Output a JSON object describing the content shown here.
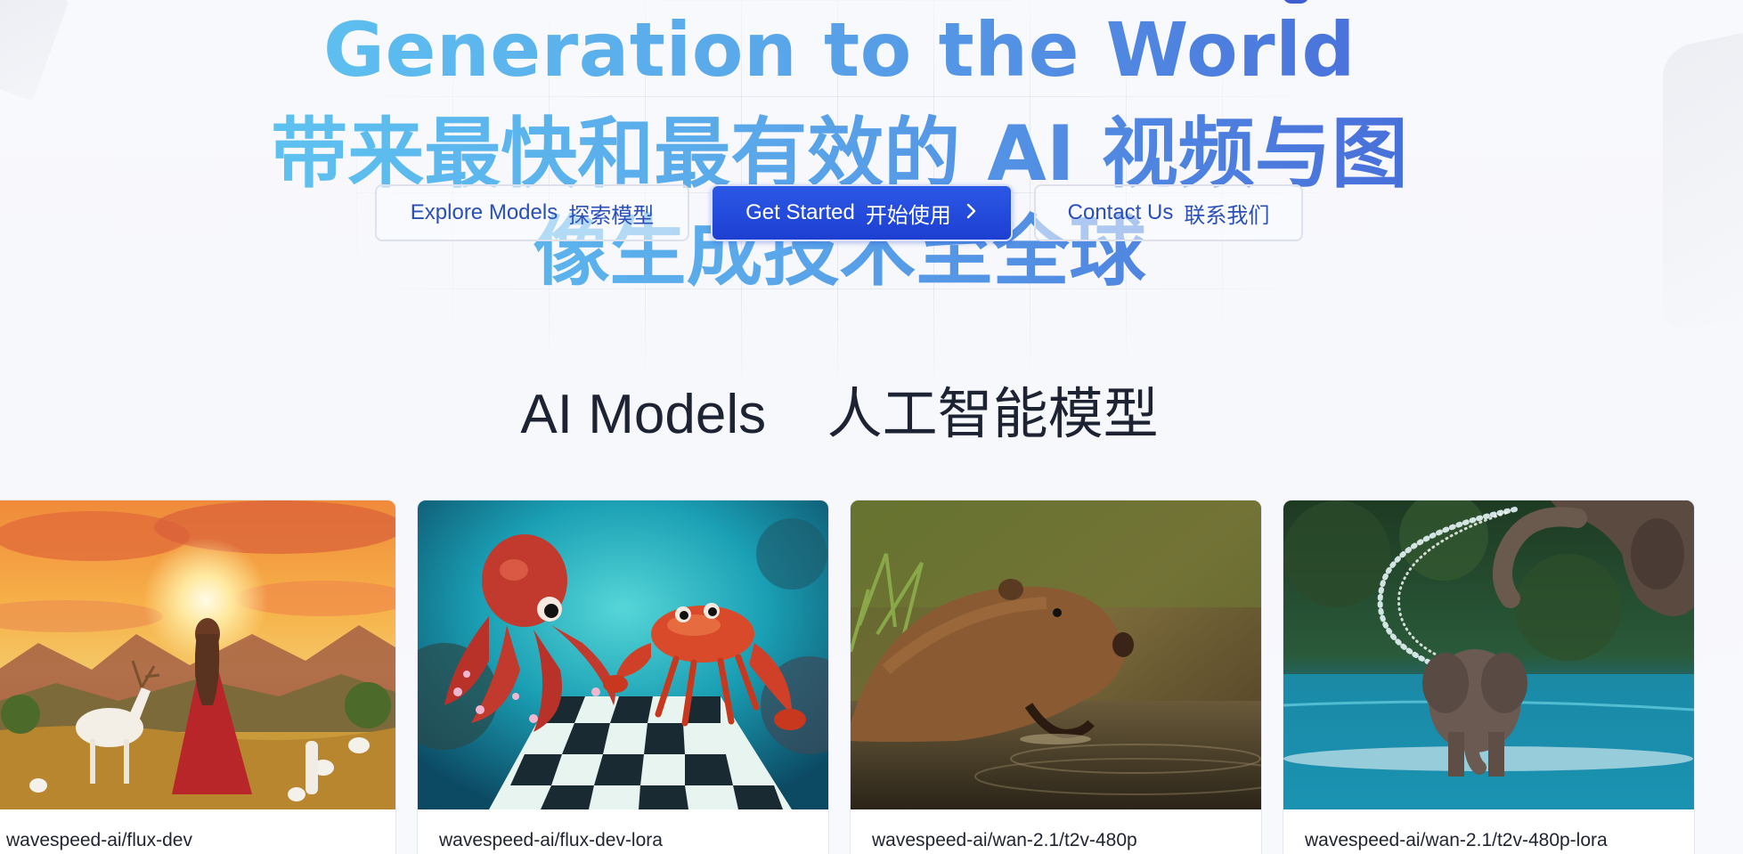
{
  "hero": {
    "headline_en": "Generation to the World",
    "headline_zh_line1": "带来最快和最有效的 AI 视频与图",
    "headline_zh_line2": "像生成技术至全球"
  },
  "cta": {
    "explore_en": "Explore Models",
    "explore_zh": "探索模型",
    "start_en": "Get Started",
    "start_zh": "开始使用",
    "start_icon": "chevron-right-icon",
    "contact_en": "Contact Us",
    "contact_zh": "联系我们"
  },
  "models_section": {
    "title_en": "AI Models",
    "title_zh": "人工智能模型",
    "cards": [
      {
        "model": "wavespeed-ai/flux-dev",
        "image": "girl-with-deer-sunset-image"
      },
      {
        "model": "wavespeed-ai/flux-dev-lora",
        "image": "octopus-crab-chess-image"
      },
      {
        "model": "wavespeed-ai/wan-2.1/t2v-480p",
        "image": "capybara-water-image"
      },
      {
        "model": "wavespeed-ai/wan-2.1/t2v-480p-lora",
        "image": "elephants-splashing-image"
      }
    ]
  },
  "colors": {
    "gradient_start": "#5fd0f3",
    "gradient_end": "#3f5ed2",
    "primary_button": "#2c58e6",
    "outline_text": "#2a4fb8",
    "title_text": "#1d2333"
  }
}
